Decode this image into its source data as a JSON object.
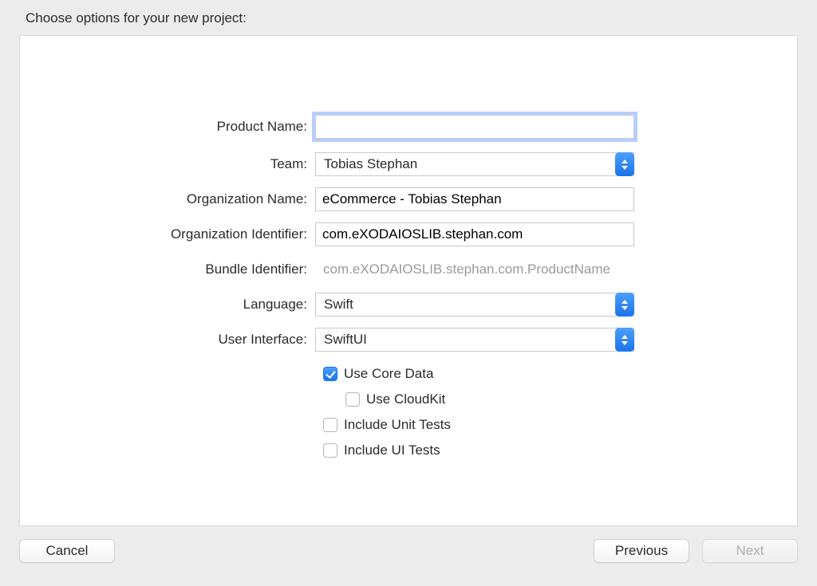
{
  "header": "Choose options for your new project:",
  "form": {
    "product_name": {
      "label": "Product Name:",
      "value": ""
    },
    "team": {
      "label": "Team:",
      "value": "Tobias Stephan"
    },
    "org_name": {
      "label": "Organization Name:",
      "value": "eCommerce - Tobias Stephan"
    },
    "org_identifier": {
      "label": "Organization Identifier:",
      "value": "com.eXODAIOSLIB.stephan.com"
    },
    "bundle_identifier": {
      "label": "Bundle Identifier:",
      "value": "com.eXODAIOSLIB.stephan.com.ProductName"
    },
    "language": {
      "label": "Language:",
      "value": "Swift"
    },
    "user_interface": {
      "label": "User Interface:",
      "value": "SwiftUI"
    }
  },
  "checkboxes": {
    "use_core_data": {
      "label": "Use Core Data",
      "checked": true
    },
    "use_cloudkit": {
      "label": "Use CloudKit",
      "checked": false
    },
    "include_unit_tests": {
      "label": "Include Unit Tests",
      "checked": false
    },
    "include_ui_tests": {
      "label": "Include UI Tests",
      "checked": false
    }
  },
  "buttons": {
    "cancel": "Cancel",
    "previous": "Previous",
    "next": "Next"
  }
}
